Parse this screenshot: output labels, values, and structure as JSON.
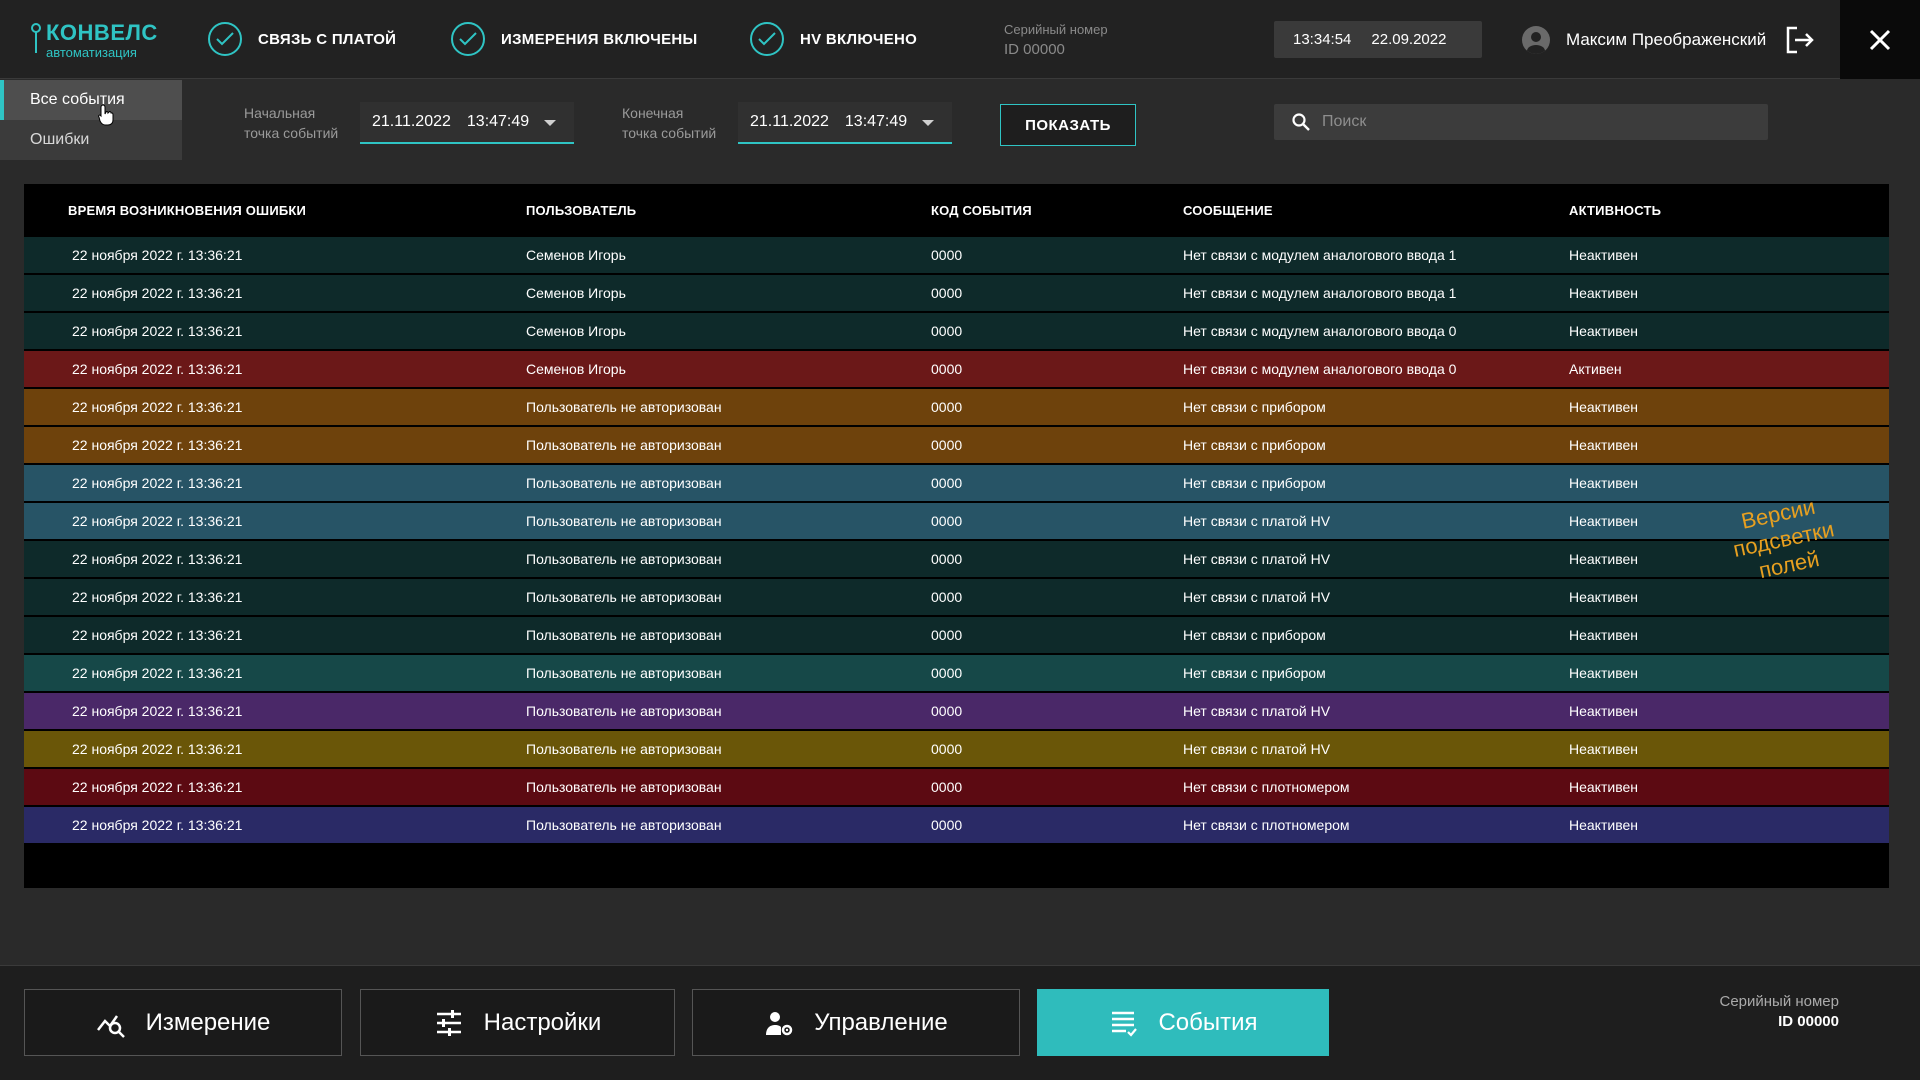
{
  "brand": {
    "name": "КОНВЕЛС",
    "tagline": "автоматизация"
  },
  "status_items": [
    {
      "label": "СВЯЗЬ С ПЛАТОЙ"
    },
    {
      "label": "ИЗМЕРЕНИЯ ВКЛЮЧЕНЫ"
    },
    {
      "label": "HV ВКЛЮЧЕНО"
    }
  ],
  "serial_top": {
    "title": "Серийный номер",
    "value": "ID 00000"
  },
  "clock": {
    "time": "13:34:54",
    "date": "22.09.2022"
  },
  "user": {
    "name": "Максим Преображенский"
  },
  "side_tabs": [
    {
      "label": "Все события",
      "active": true
    },
    {
      "label": "Ошибки",
      "active": false
    }
  ],
  "filters": {
    "start_label_1": "Начальная",
    "start_label_2": "точка событий",
    "start_date": "21.11.2022",
    "start_time": "13:47:49",
    "end_label_1": "Конечная",
    "end_label_2": "точка событий",
    "end_date": "21.11.2022",
    "end_time": "13:47:49",
    "show_label": "ПОКАЗАТЬ"
  },
  "search": {
    "placeholder": "Поиск"
  },
  "table": {
    "columns": [
      "ВРЕМЯ ВОЗНИКНОВЕНИЯ ОШИБКИ",
      "ПОЛЬЗОВАТЕЛЬ",
      "КОД СОБЫТИЯ",
      "СООБЩЕНИЕ",
      "АКТИВНОСТЬ"
    ],
    "rows": [
      {
        "time": "22 ноября 2022 г. 13:36:21",
        "user": "Семенов Игорь",
        "code": "0000",
        "message": "Нет связи с модулем аналогового ввода 1",
        "activity": "Неактивен",
        "color": "#0e2a2a"
      },
      {
        "time": "22 ноября 2022 г. 13:36:21",
        "user": "Семенов Игорь",
        "code": "0000",
        "message": "Нет связи с модулем аналогового ввода 1",
        "activity": "Неактивен",
        "color": "#0e2a2a"
      },
      {
        "time": "22 ноября 2022 г. 13:36:21",
        "user": "Семенов Игорь",
        "code": "0000",
        "message": "Нет связи с модулем аналогового ввода 0",
        "activity": "Неактивен",
        "color": "#0e2a2a"
      },
      {
        "time": "22 ноября 2022 г. 13:36:21",
        "user": "Семенов Игорь",
        "code": "0000",
        "message": "Нет связи с модулем аналогового ввода 0",
        "activity": "Активен",
        "color": "#6b1818"
      },
      {
        "time": "22 ноября 2022 г. 13:36:21",
        "user": "Пользователь не авторизован",
        "code": "0000",
        "message": "Нет связи с прибором",
        "activity": "Неактивен",
        "color": "#6e420c"
      },
      {
        "time": "22 ноября 2022 г. 13:36:21",
        "user": "Пользователь не авторизован",
        "code": "0000",
        "message": "Нет связи с прибором",
        "activity": "Неактивен",
        "color": "#6e420c"
      },
      {
        "time": "22 ноября 2022 г. 13:36:21",
        "user": "Пользователь не авторизован",
        "code": "0000",
        "message": "Нет связи с прибором",
        "activity": "Неактивен",
        "color": "#275466"
      },
      {
        "time": "22 ноября 2022 г. 13:36:21",
        "user": "Пользователь не авторизован",
        "code": "0000",
        "message": "Нет связи с платой HV",
        "activity": "Неактивен",
        "color": "#275466"
      },
      {
        "time": "22 ноября 2022 г. 13:36:21",
        "user": "Пользователь не авторизован",
        "code": "0000",
        "message": "Нет связи с платой HV",
        "activity": "Неактивен",
        "color": "#0e2a2a"
      },
      {
        "time": "22 ноября 2022 г. 13:36:21",
        "user": "Пользователь не авторизован",
        "code": "0000",
        "message": "Нет связи с платой HV",
        "activity": "Неактивен",
        "color": "#0e2a2a"
      },
      {
        "time": "22 ноября 2022 г. 13:36:21",
        "user": "Пользователь не авторизован",
        "code": "0000",
        "message": "Нет связи с прибором",
        "activity": "Неактивен",
        "color": "#0e2a2a"
      },
      {
        "time": "22 ноября 2022 г. 13:36:21",
        "user": "Пользователь не авторизован",
        "code": "0000",
        "message": "Нет связи с прибором",
        "activity": "Неактивен",
        "color": "#164848"
      },
      {
        "time": "22 ноября 2022 г. 13:36:21",
        "user": "Пользователь не авторизован",
        "code": "0000",
        "message": "Нет связи с платой HV",
        "activity": "Неактивен",
        "color": "#4a2868"
      },
      {
        "time": "22 ноября 2022 г. 13:36:21",
        "user": "Пользователь не авторизован",
        "code": "0000",
        "message": "Нет связи с платой HV",
        "activity": "Неактивен",
        "color": "#6a5608"
      },
      {
        "time": "22 ноября 2022 г. 13:36:21",
        "user": "Пользователь не авторизован",
        "code": "0000",
        "message": "Нет связи с плотномером",
        "activity": "Неактивен",
        "color": "#5c0a12"
      },
      {
        "time": "22 ноября 2022 г. 13:36:21",
        "user": "Пользователь не авторизован",
        "code": "0000",
        "message": "Нет связи с плотномером",
        "activity": "Неактивен",
        "color": "#2a2a66"
      }
    ]
  },
  "annotation": {
    "line1": "Версии",
    "line2": "подсветки",
    "line3": "полей"
  },
  "bottom_nav": [
    {
      "label": "Измерение",
      "icon": "measurement-icon",
      "active": false
    },
    {
      "label": "Настройки",
      "icon": "sliders-icon",
      "active": false
    },
    {
      "label": "Управление",
      "icon": "user-gear-icon",
      "active": false
    },
    {
      "label": "События",
      "icon": "events-list-icon",
      "active": true
    }
  ],
  "serial_bottom": {
    "title": "Серийный номер",
    "value": "ID 00000"
  },
  "colors": {
    "accent": "#2fc4c4",
    "annotation": "#e8a020"
  }
}
